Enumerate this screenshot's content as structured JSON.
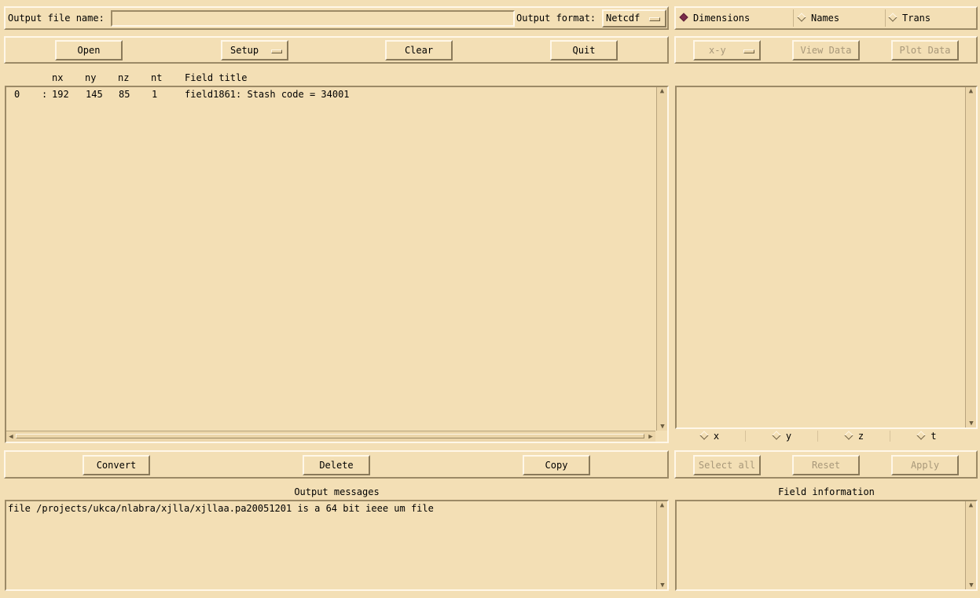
{
  "top": {
    "output_file_label": "Output file name:",
    "output_file_value": "",
    "output_format_label": "Output format:",
    "output_format_value": "Netcdf"
  },
  "view_modes": [
    {
      "label": "Dimensions",
      "selected": true
    },
    {
      "label": "Names",
      "selected": false
    },
    {
      "label": "Trans",
      "selected": false
    }
  ],
  "toolbar": {
    "open": "Open",
    "setup": "Setup",
    "clear": "Clear",
    "quit": "Quit"
  },
  "plot_toolbar": {
    "plot_type": "x-y",
    "view_data": "View Data",
    "plot_data": "Plot Data"
  },
  "fields_table": {
    "headers": {
      "nx": "nx",
      "ny": "ny",
      "nz": "nz",
      "nt": "nt",
      "title": "Field title"
    },
    "rows": [
      {
        "index": "0",
        "sep": ":",
        "nx": "192",
        "ny": "145",
        "nz": "85",
        "nt": "1",
        "title": "field1861: Stash code = 34001"
      }
    ]
  },
  "dim_toggles": [
    "x",
    "y",
    "z",
    "t"
  ],
  "actions": {
    "convert": "Convert",
    "delete": "Delete",
    "copy": "Copy"
  },
  "dim_actions": {
    "select_all": "Select all",
    "reset": "Reset",
    "apply": "Apply"
  },
  "output_messages": {
    "title": "Output messages",
    "lines": [
      "file /projects/ukca/nlabra/xjlla/xjllaa.pa20051201 is a 64 bit ieee um file"
    ]
  },
  "field_information": {
    "title": "Field information"
  },
  "colors": {
    "background": "#f3dfb5",
    "radio_selected": "#7a2b4a",
    "disabled_text": "#a8987a"
  }
}
